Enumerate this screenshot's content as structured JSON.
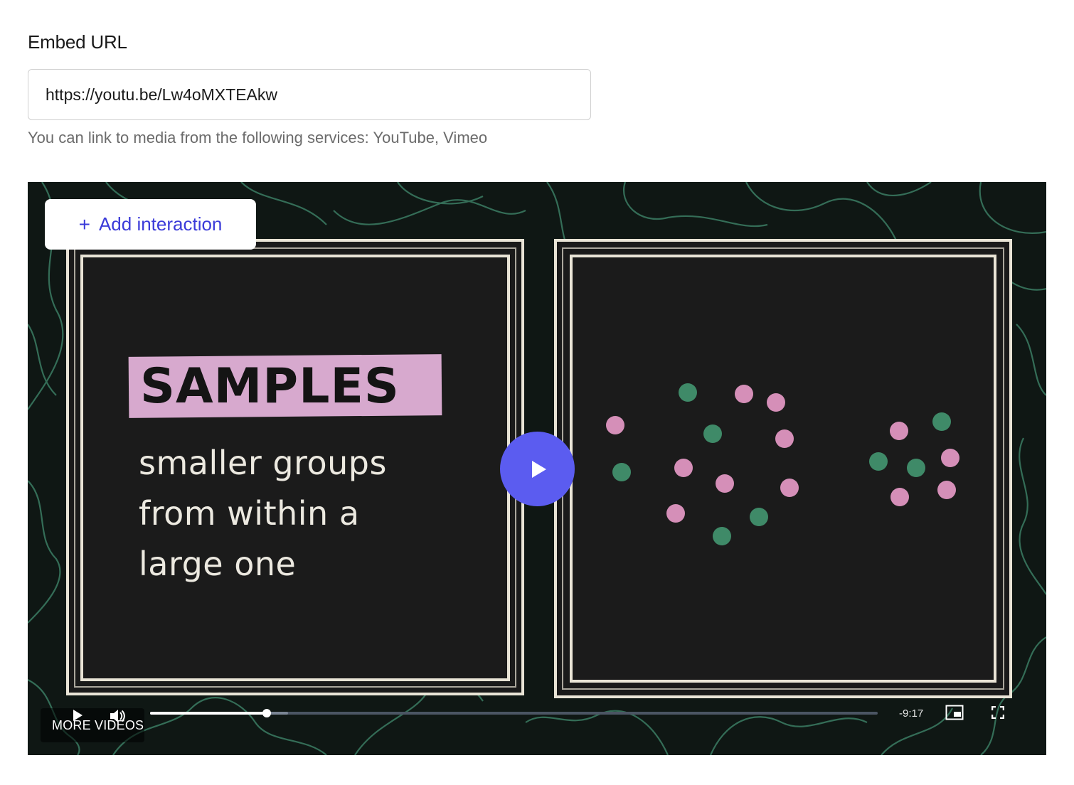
{
  "form": {
    "label": "Embed URL",
    "url_value": "https://youtu.be/Lw4oMXTEAkw",
    "help_text": "You can link to media from the following services: YouTube, Vimeo"
  },
  "player": {
    "add_interaction_label": "Add interaction",
    "add_interaction_prefix": "+",
    "video": {
      "heading": "SAMPLES",
      "lines": [
        "smaller groups",
        "from within a",
        "large one"
      ]
    },
    "controls": {
      "more_videos_label": "MORE VIDEOS",
      "time_remaining": "-9:17",
      "progress": 0.16,
      "buffered": 0.19
    },
    "colors": {
      "accent": "#5b5cf0",
      "button_text": "#3b3bd9",
      "dot_pink": "#d58fb8",
      "dot_green": "#3f8a68"
    }
  }
}
